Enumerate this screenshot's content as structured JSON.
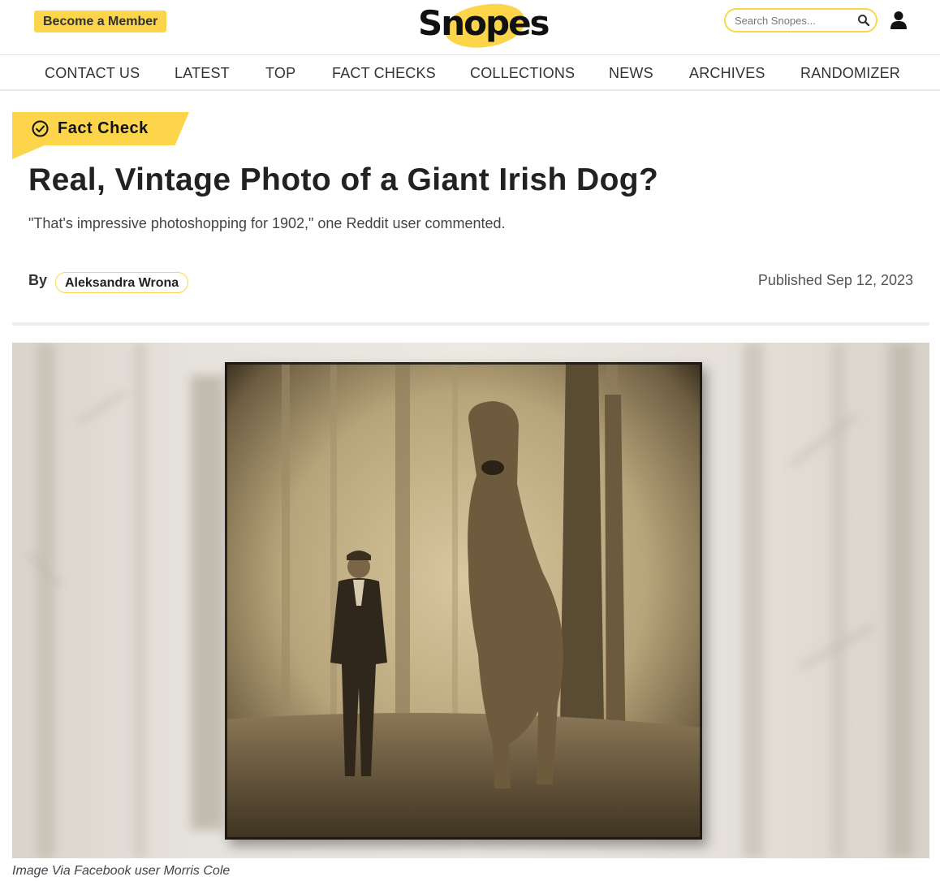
{
  "header": {
    "member_button": "Become a Member",
    "logo_text": "Snopes",
    "search_placeholder": "Search Snopes...",
    "brand_color": "#fcd54a"
  },
  "nav": {
    "items": [
      "CONTACT US",
      "LATEST",
      "TOP",
      "FACT CHECKS",
      "COLLECTIONS",
      "NEWS",
      "ARCHIVES",
      "RANDOMIZER"
    ]
  },
  "article": {
    "tag_label": "Fact Check",
    "title": "Real, Vintage Photo of a Giant Irish Dog?",
    "subtitle": "\"That's impressive photoshopping for 1902,\" one Reddit user commented.",
    "by_label": "By",
    "author": "Aleksandra Wrona",
    "published": "Published Sep 12, 2023",
    "image_caption": "Image Via Facebook user Morris Cole"
  }
}
